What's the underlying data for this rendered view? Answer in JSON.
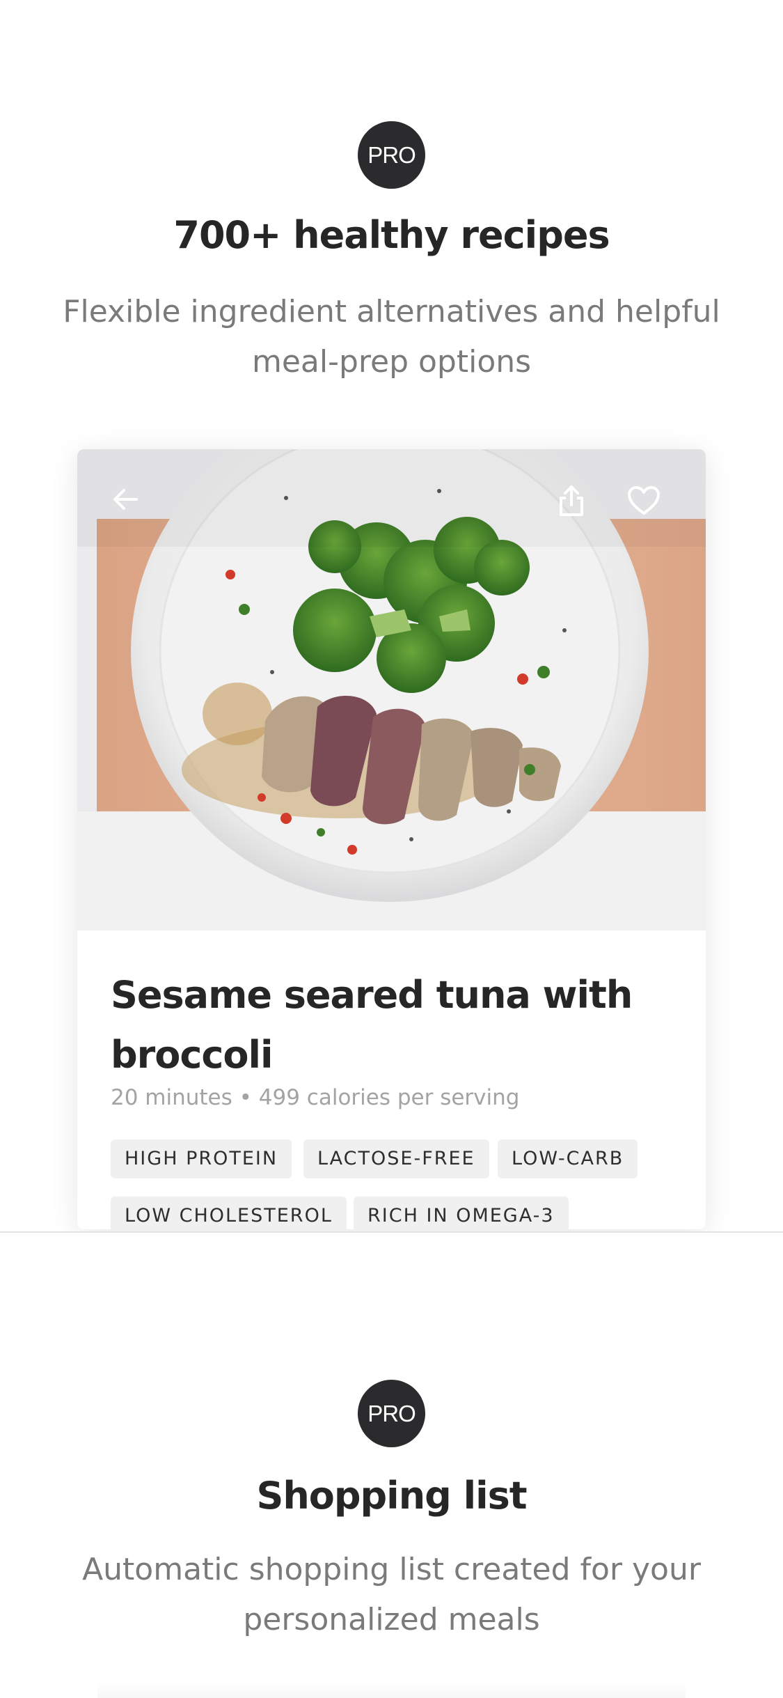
{
  "feature_recipes": {
    "badge": "PRO",
    "title": "700+ healthy recipes",
    "description": "Flexible ingredient alternatives and helpful meal-prep options"
  },
  "recipe_card": {
    "photo_description_icon_names": {
      "back": "arrow-left-icon",
      "share": "share-icon",
      "favorite": "heart-icon"
    },
    "title": "Sesame seared tuna with broccoli",
    "meta": "20 minutes • 499 calories per serving",
    "tags": [
      "HIGH PROTEIN",
      "LACTOSE-FREE",
      "LOW-CARB",
      "LOW CHOLESTEROL",
      "RICH IN OMEGA-3"
    ]
  },
  "feature_shopping": {
    "badge": "PRO",
    "title": "Shopping list",
    "description": "Automatic shopping list created for your personalized meals"
  },
  "colors": {
    "badge_bg": "#2b2b2e",
    "title": "#262626",
    "description": "#7a7a7a",
    "meta": "#a3a3a3",
    "tag_bg": "#f0f0f0"
  }
}
